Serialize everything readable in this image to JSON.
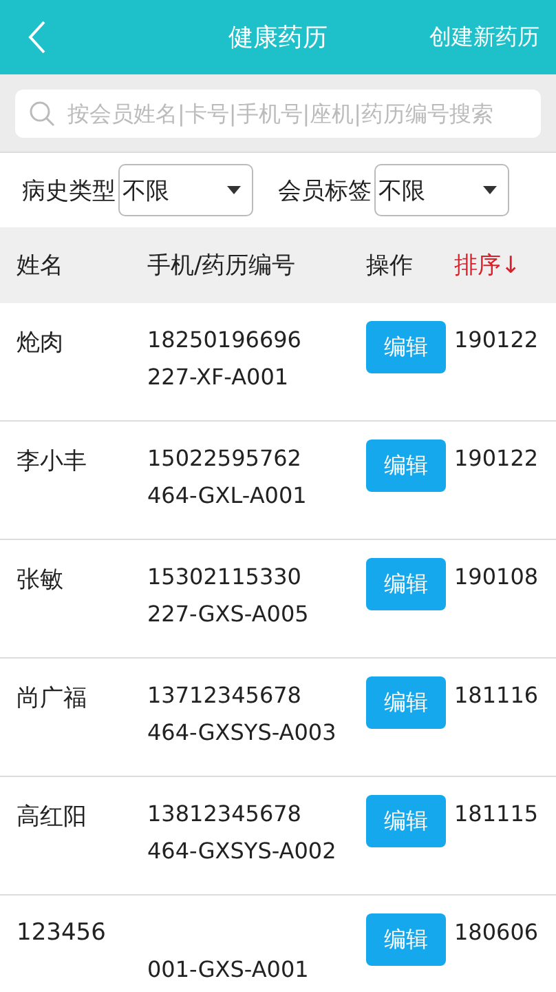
{
  "header": {
    "title": "健康药历",
    "action": "创建新药历"
  },
  "search": {
    "placeholder": "按会员姓名|卡号|手机号|座机|药历编号搜索"
  },
  "filters": [
    {
      "label": "病史类型",
      "value": "不限"
    },
    {
      "label": "会员标签",
      "value": "不限"
    }
  ],
  "table": {
    "columns": [
      {
        "label": "姓名",
        "kind": "plain"
      },
      {
        "label": "手机/药历编号",
        "kind": "plain"
      },
      {
        "label": "操作",
        "kind": "plain"
      },
      {
        "label": "排序↓",
        "kind": "sort"
      }
    ],
    "rows": [
      {
        "name": "炝肉",
        "phone": "18250196696",
        "record": "227-XF-A001",
        "action": "编辑",
        "sort": "190122"
      },
      {
        "name": "李小丰",
        "phone": "15022595762",
        "record": "464-GXL-A001",
        "action": "编辑",
        "sort": "190122"
      },
      {
        "name": "张敏",
        "phone": "15302115330",
        "record": "227-GXS-A005",
        "action": "编辑",
        "sort": "190108"
      },
      {
        "name": "尚广福",
        "phone": "13712345678",
        "record": "464-GXSYS-A003",
        "action": "编辑",
        "sort": "181116"
      },
      {
        "name": "高红阳",
        "phone": "13812345678",
        "record": "464-GXSYS-A002",
        "action": "编辑",
        "sort": "181115"
      },
      {
        "name": "123456",
        "record": "001-GXS-A001",
        "action": "编辑",
        "sort": "180606"
      }
    ]
  }
}
